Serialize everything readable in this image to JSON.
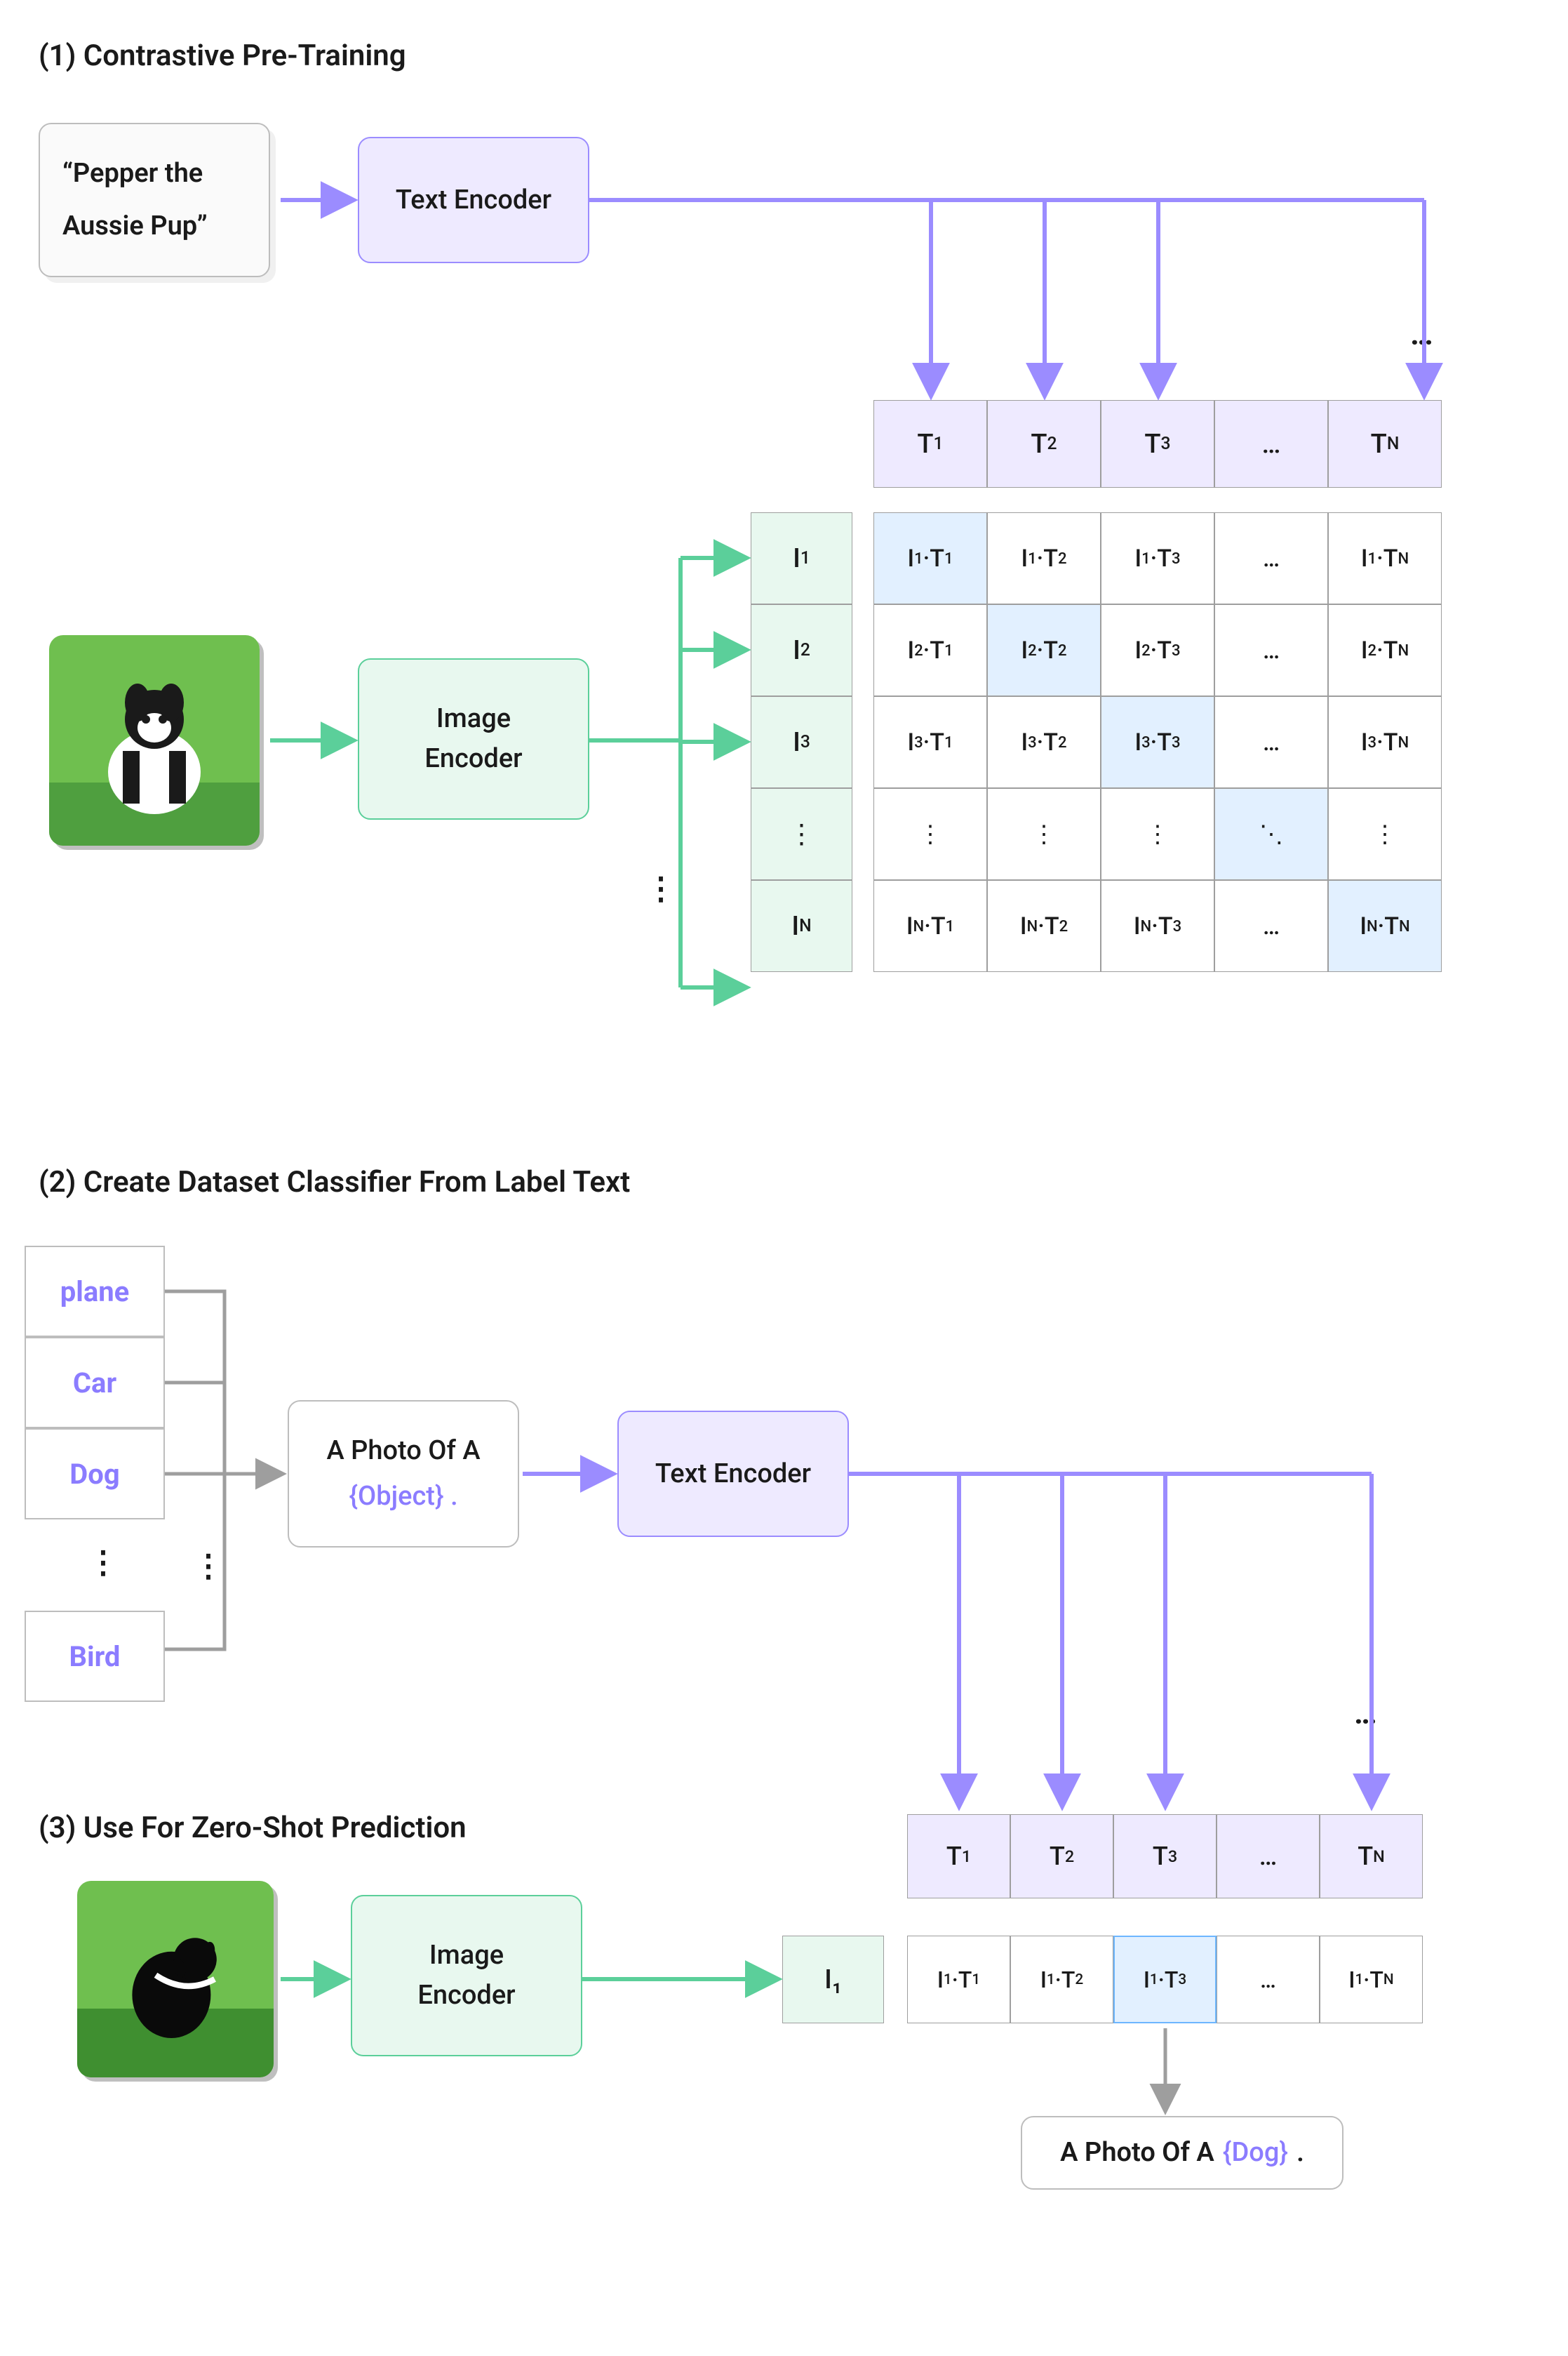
{
  "section1": {
    "title": "(1) Contrastive Pre-Training"
  },
  "section2": {
    "title": "(2) Create Dataset Classifier From Label Text"
  },
  "section3": {
    "title": "(3) Use For Zero-Shot Prediction"
  },
  "text_input": {
    "line1": "“Pepper the",
    "line2": "Aussie Pup”"
  },
  "encoders": {
    "text": "Text Encoder",
    "image": "Image\nEncoder"
  },
  "heads_T": [
    "T₁",
    "T₂",
    "T₃",
    "…",
    "Tₙ"
  ],
  "heads_T_disp": [
    "T₁",
    "T₂",
    "T₃",
    "…",
    "Tɴ"
  ],
  "heads_I": [
    "I₁",
    "I₂",
    "I₃",
    "⋮",
    "Iɴ"
  ],
  "matrix": [
    [
      "I₁·T₁",
      "I₁·T₂",
      "I₁·T₃",
      "…",
      "I₁·Tɴ"
    ],
    [
      "I₂·T₁",
      "I₂·T₂",
      "I₂·T₃",
      "…",
      "I₂·Tɴ"
    ],
    [
      "I₃·T₁",
      "I₃·T₂",
      "I₃·T₃",
      "…",
      "I₃·Tɴ"
    ],
    [
      "⋮",
      "⋮",
      "⋮",
      "⋱",
      "⋮"
    ],
    [
      "Iɴ·T₁",
      "Iɴ·T₂",
      "Iɴ·T₃",
      "…",
      "Iɴ·Tɴ"
    ]
  ],
  "labels": [
    "plane",
    "Car",
    "Dog",
    "⋮",
    "Bird"
  ],
  "prompt": {
    "line1": "A Photo Of A",
    "line2": "{Object} ."
  },
  "zeroshot": {
    "heads_T": [
      "T₁",
      "T₂",
      "T₃",
      "…",
      "Tɴ"
    ],
    "I": "I₁",
    "row": [
      "I₁·T₁",
      "I₁·T₂",
      "I₁·T₃",
      "…",
      "I₁·Tɴ"
    ],
    "result_pre": "A Photo Of A ",
    "result_obj": "{Dog}",
    "result_post": " ."
  },
  "ellipsis_h": "…",
  "ellipsis_v": "⋮"
}
